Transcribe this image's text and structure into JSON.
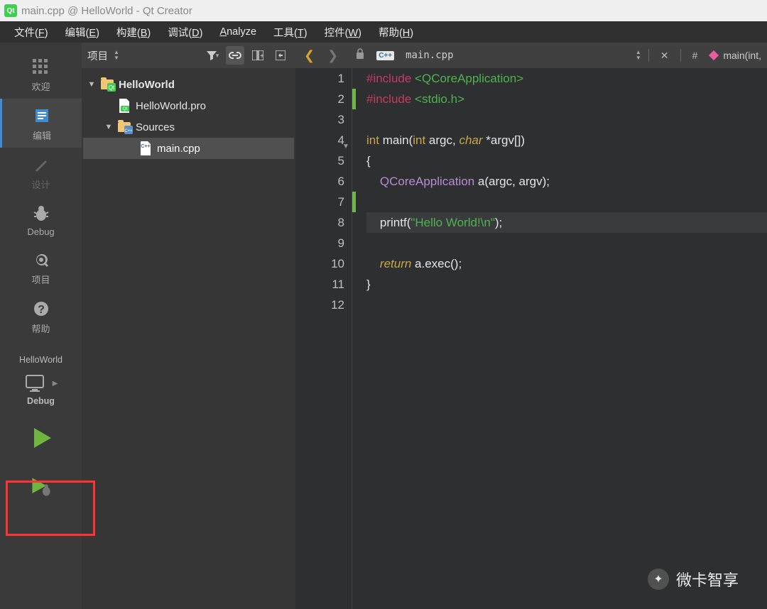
{
  "window": {
    "title": "main.cpp @ HelloWorld - Qt Creator"
  },
  "menubar": [
    {
      "label": "文件(F)",
      "hotkey": "F"
    },
    {
      "label": "编辑(E)",
      "hotkey": "E"
    },
    {
      "label": "构建(B)",
      "hotkey": "B"
    },
    {
      "label": "调试(D)",
      "hotkey": "D"
    },
    {
      "label": "Analyze",
      "hotkey": "A"
    },
    {
      "label": "工具(T)",
      "hotkey": "T"
    },
    {
      "label": "控件(W)",
      "hotkey": "W"
    },
    {
      "label": "帮助(H)",
      "hotkey": "H"
    }
  ],
  "sidebar": {
    "items": [
      {
        "id": "welcome",
        "label": "欢迎"
      },
      {
        "id": "edit",
        "label": "编辑",
        "active": true
      },
      {
        "id": "design",
        "label": "设计",
        "disabled": true
      },
      {
        "id": "debug",
        "label": "Debug"
      },
      {
        "id": "projects",
        "label": "项目"
      },
      {
        "id": "help",
        "label": "帮助"
      }
    ],
    "project_label": "HelloWorld",
    "kit_label": "Debug"
  },
  "projectPanel": {
    "combo": "项目",
    "tree": [
      {
        "level": 0,
        "name": "HelloWorld",
        "icon": "project-folder",
        "bold": true,
        "expanded": true
      },
      {
        "level": 1,
        "name": "HelloWorld.pro",
        "icon": "pro-file"
      },
      {
        "level": 1,
        "name": "Sources",
        "icon": "src-folder",
        "expanded": true
      },
      {
        "level": 2,
        "name": "main.cpp",
        "icon": "cpp-file",
        "selected": true
      }
    ]
  },
  "editorToolbar": {
    "filename": "main.cpp",
    "hash": "#",
    "symbol": "main(int,"
  },
  "code": {
    "current_line": 8,
    "modified_lines": [
      2,
      7
    ],
    "fold_line": 4,
    "lines": [
      {
        "n": 1,
        "tokens": [
          [
            "kw-pp",
            "#include"
          ],
          [
            "",
            ""
          ],
          [
            "kw-inc",
            " <QCoreApplication>"
          ]
        ]
      },
      {
        "n": 2,
        "tokens": [
          [
            "kw-pp",
            "#include"
          ],
          [
            "",
            ""
          ],
          [
            "kw-inc",
            " <stdio.h>"
          ]
        ]
      },
      {
        "n": 3,
        "tokens": [
          [
            "",
            ""
          ]
        ]
      },
      {
        "n": 4,
        "tokens": [
          [
            "kw-type",
            "int"
          ],
          [
            "",
            " "
          ],
          [
            "kw-func",
            "main"
          ],
          [
            "punct",
            "("
          ],
          [
            "kw-type",
            "int"
          ],
          [
            "",
            " argc, "
          ],
          [
            "kw-char",
            "char"
          ],
          [
            "",
            " *argv"
          ],
          [
            "punct",
            "[])"
          ]
        ]
      },
      {
        "n": 5,
        "tokens": [
          [
            "punct",
            "{"
          ]
        ]
      },
      {
        "n": 6,
        "tokens": [
          [
            "",
            "    "
          ],
          [
            "cls",
            "QCoreApplication"
          ],
          [
            "",
            " a"
          ],
          [
            "punct",
            "("
          ],
          [
            "",
            "argc, argv"
          ],
          [
            "punct",
            ");"
          ]
        ]
      },
      {
        "n": 7,
        "tokens": [
          [
            "",
            ""
          ]
        ]
      },
      {
        "n": 8,
        "tokens": [
          [
            "",
            "    printf"
          ],
          [
            "punct",
            "("
          ],
          [
            "str",
            "\"Hello World!\\n\""
          ],
          [
            "punct",
            ");"
          ]
        ]
      },
      {
        "n": 9,
        "tokens": [
          [
            "",
            ""
          ]
        ]
      },
      {
        "n": 10,
        "tokens": [
          [
            "",
            "    "
          ],
          [
            "kw-ret",
            "return"
          ],
          [
            "",
            " a.exec"
          ],
          [
            "punct",
            "();"
          ]
        ]
      },
      {
        "n": 11,
        "tokens": [
          [
            "punct",
            "}"
          ]
        ]
      },
      {
        "n": 12,
        "tokens": [
          [
            "",
            ""
          ]
        ]
      }
    ]
  },
  "watermark": "微卡智享"
}
